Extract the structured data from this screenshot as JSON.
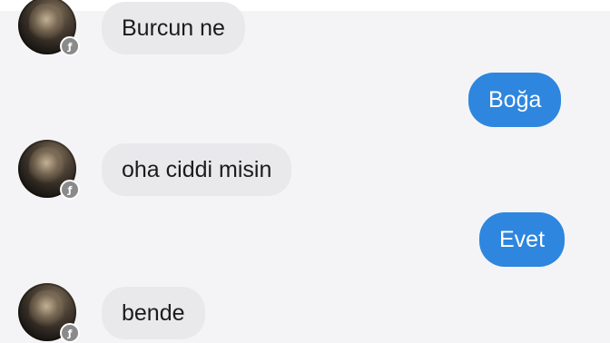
{
  "messages": [
    {
      "side": "incoming",
      "text": "Burcun ne"
    },
    {
      "side": "outgoing",
      "text": "Boğa"
    },
    {
      "side": "incoming",
      "text": "oha ciddi misin"
    },
    {
      "side": "outgoing",
      "text": "Evet"
    },
    {
      "side": "incoming",
      "text": "bende"
    }
  ],
  "colors": {
    "incoming_bubble": "#e9e9ec",
    "outgoing_bubble": "#2e86de",
    "chat_background": "#f4f4f6"
  },
  "icons": {
    "avatar_badge": "messenger-badge-icon"
  }
}
